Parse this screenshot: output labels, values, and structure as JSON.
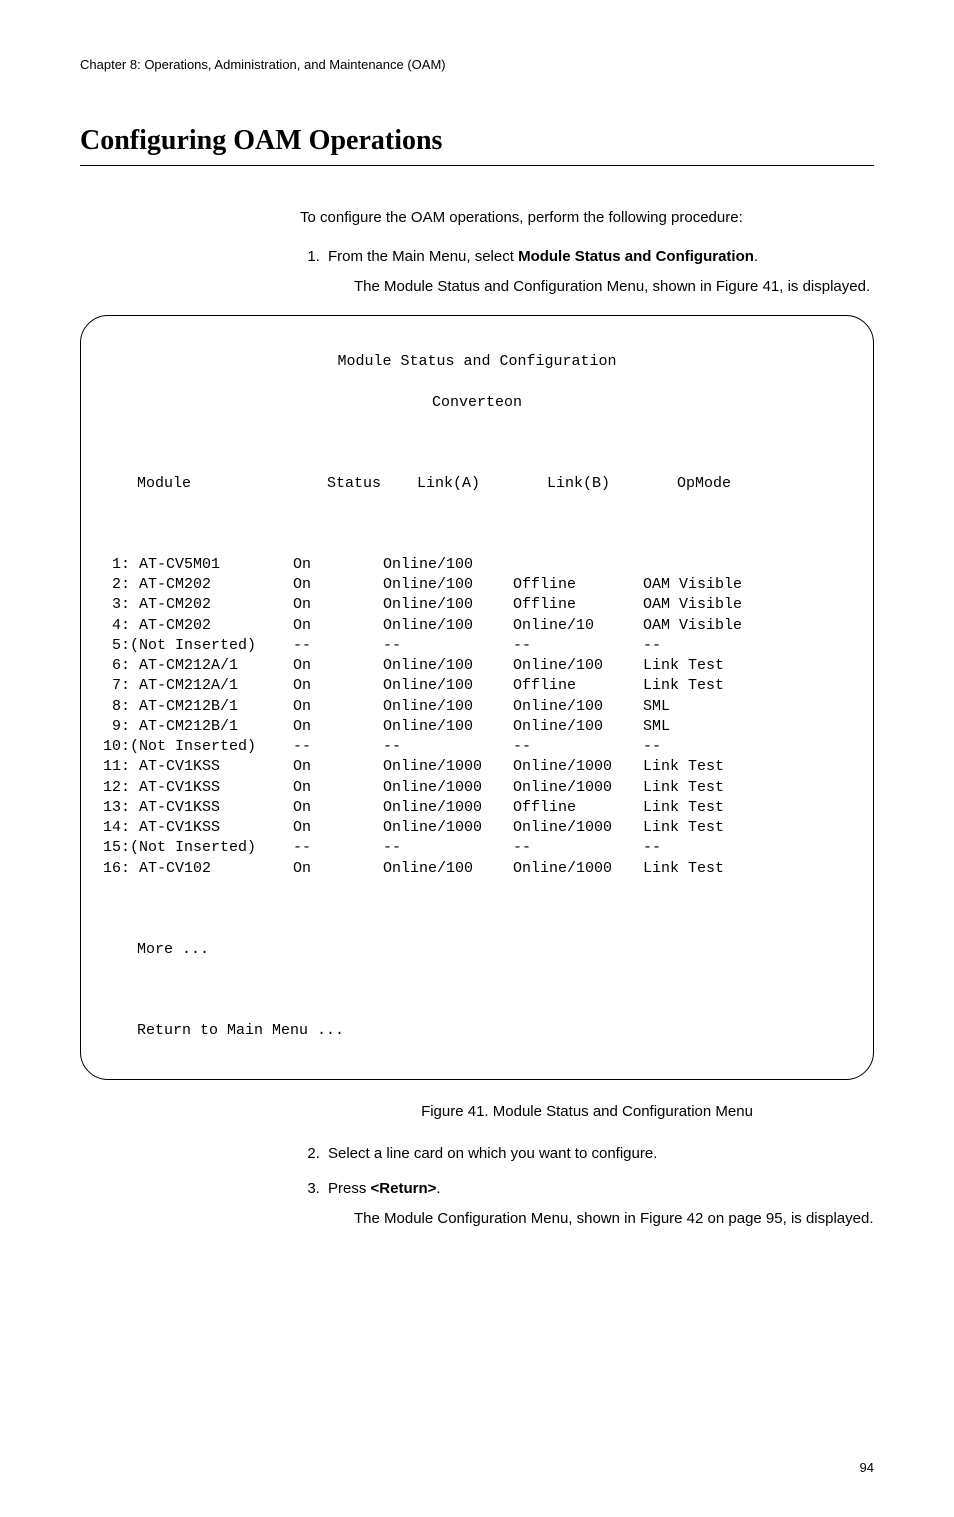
{
  "chapter_header": "Chapter 8: Operations, Administration, and Maintenance (OAM)",
  "section_title": "Configuring OAM Operations",
  "intro": "To configure the OAM operations, perform the following procedure:",
  "step1_a": "From the Main Menu, select ",
  "step1_b": "Module Status and Configuration",
  "step1_c": ".",
  "step1_result": "The Module Status and Configuration Menu, shown in Figure 41, is displayed.",
  "terminal": {
    "title_line1": "Module Status and Configuration",
    "title_line2": "Converteon",
    "headers": {
      "module": "Module",
      "status": "Status",
      "linka": "Link(A)",
      "linkb": "Link(B)",
      "opmode": "OpMode"
    },
    "rows": [
      {
        "module": " 1: AT-CV5M01",
        "status": "On",
        "linka": "Online/100",
        "linkb": "",
        "opmode": ""
      },
      {
        "module": " 2: AT-CM202",
        "status": "On",
        "linka": "Online/100",
        "linkb": "Offline",
        "opmode": "OAM Visible"
      },
      {
        "module": " 3: AT-CM202",
        "status": "On",
        "linka": "Online/100",
        "linkb": "Offline",
        "opmode": "OAM Visible"
      },
      {
        "module": " 4: AT-CM202",
        "status": "On",
        "linka": "Online/100",
        "linkb": "Online/10",
        "opmode": "OAM Visible"
      },
      {
        "module": " 5:(Not Inserted)",
        "status": "--",
        "linka": "--",
        "linkb": "--",
        "opmode": "--"
      },
      {
        "module": " 6: AT-CM212A/1",
        "status": "On",
        "linka": "Online/100",
        "linkb": "Online/100",
        "opmode": "Link Test"
      },
      {
        "module": " 7: AT-CM212A/1",
        "status": "On",
        "linka": "Online/100",
        "linkb": "Offline",
        "opmode": "Link Test"
      },
      {
        "module": " 8: AT-CM212B/1",
        "status": "On",
        "linka": "Online/100",
        "linkb": "Online/100",
        "opmode": "SML"
      },
      {
        "module": " 9: AT-CM212B/1",
        "status": "On",
        "linka": "Online/100",
        "linkb": "Online/100",
        "opmode": "SML"
      },
      {
        "module": "10:(Not Inserted)",
        "status": "--",
        "linka": "--",
        "linkb": "--",
        "opmode": "--"
      },
      {
        "module": "11: AT-CV1KSS",
        "status": "On",
        "linka": "Online/1000",
        "linkb": "Online/1000",
        "opmode": "Link Test"
      },
      {
        "module": "12: AT-CV1KSS",
        "status": "On",
        "linka": "Online/1000",
        "linkb": "Online/1000",
        "opmode": "Link Test"
      },
      {
        "module": "13: AT-CV1KSS",
        "status": "On",
        "linka": "Online/1000",
        "linkb": "Offline",
        "opmode": "Link Test"
      },
      {
        "module": "14: AT-CV1KSS",
        "status": "On",
        "linka": "Online/1000",
        "linkb": "Online/1000",
        "opmode": "Link Test"
      },
      {
        "module": "15:(Not Inserted)",
        "status": "--",
        "linka": "--",
        "linkb": "--",
        "opmode": "--"
      },
      {
        "module": "16: AT-CV102",
        "status": "On",
        "linka": "Online/100",
        "linkb": "Online/1000",
        "opmode": "Link Test"
      }
    ],
    "more": "More ...",
    "return": "Return to Main Menu ..."
  },
  "figure_caption": "Figure 41. Module Status and Configuration Menu",
  "step2": "Select a line card on which you want to configure.",
  "step3_a": "Press ",
  "step3_b": "<Return>",
  "step3_c": ".",
  "step3_result": "The Module Configuration Menu, shown in Figure 42 on page 95, is displayed.",
  "page_number": "94"
}
